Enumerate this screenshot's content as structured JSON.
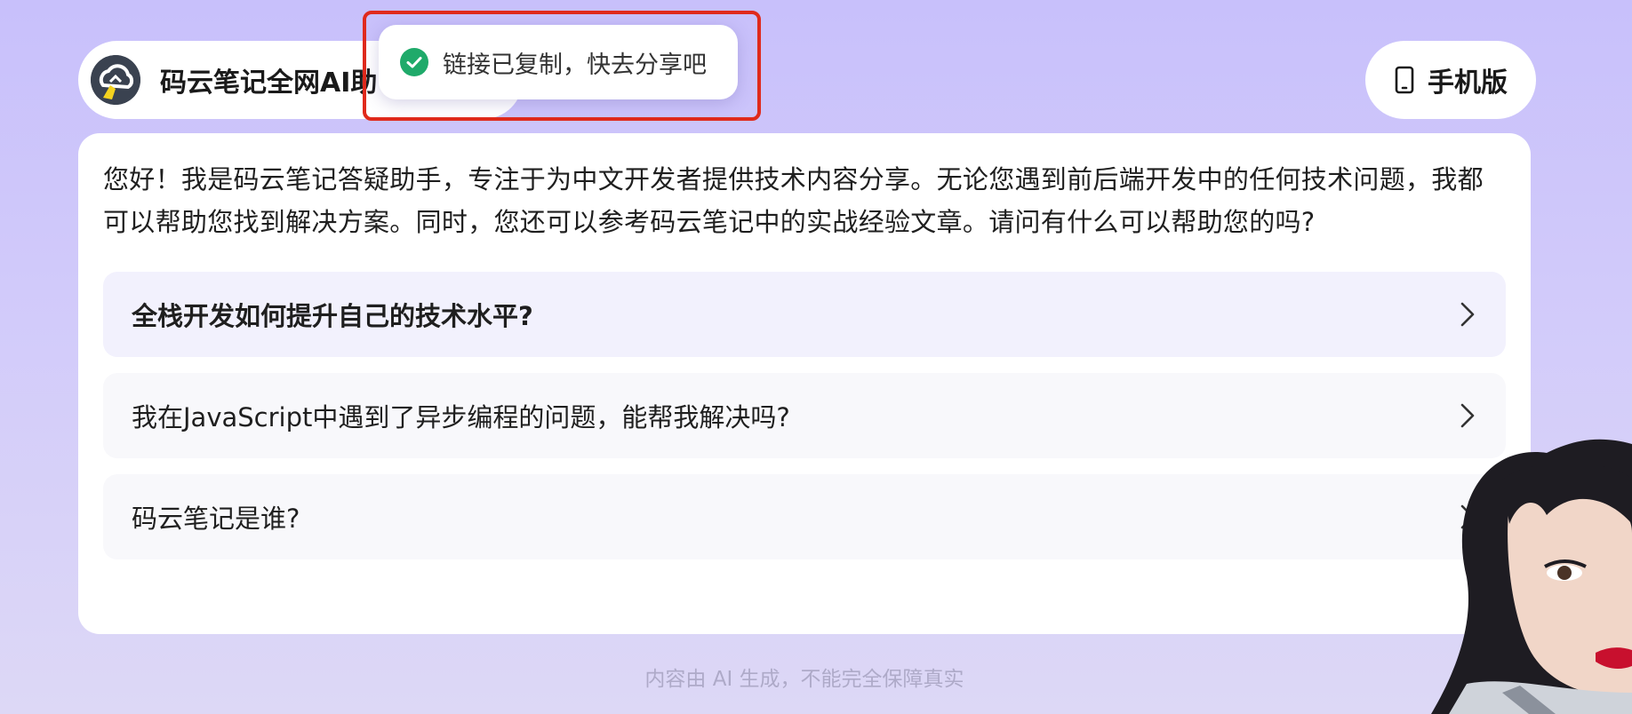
{
  "header": {
    "title": "码云笔记全网AI助",
    "mobile_label": "手机版"
  },
  "toast": {
    "message": "链接已复制，快去分享吧"
  },
  "card": {
    "intro": "您好！我是码云笔记答疑助手，专注于为中文开发者提供技术内容分享。无论您遇到前后端开发中的任何技术问题，我都可以帮助您找到解决方案。同时，您还可以参考码云笔记中的实战经验文章。请问有什么可以帮助您的吗?",
    "suggestions": [
      {
        "text": "全栈开发如何提升自己的技术水平?"
      },
      {
        "text": "我在JavaScript中遇到了异步编程的问题，能帮我解决吗?"
      },
      {
        "text": "码云笔记是谁?"
      }
    ]
  },
  "footer": {
    "note": "内容由 AI 生成，不能完全保障真实"
  },
  "colors": {
    "background": "#c8c0fb",
    "highlight": "#e02a1c",
    "success": "#1faa6a"
  }
}
